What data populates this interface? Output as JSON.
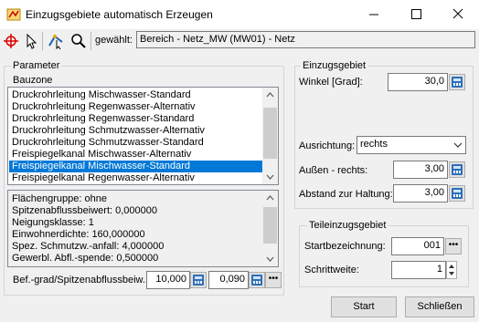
{
  "window": {
    "title": "Einzugsgebiete automatisch Erzeugen"
  },
  "toolbar": {
    "selected_label": "gewählt:",
    "selected_value": "Bereich - Netz_MW (MW01) - Netz"
  },
  "parameter": {
    "group_label": "Parameter",
    "bauzone_label": "Bauzone",
    "list_items": [
      "Druckrohrleitung Mischwasser-Standard",
      "Druckrohrleitung Regenwasser-Alternativ",
      "Druckrohrleitung Regenwasser-Standard",
      "Druckrohrleitung Schmutzwasser-Alternativ",
      "Druckrohrleitung Schmutzwasser-Standard",
      "Freispiegelkanal Mischwasser-Alternativ",
      "Freispiegelkanal Mischwasser-Standard",
      "Freispiegelkanal Regenwasser-Alternativ"
    ],
    "selected_index": 6,
    "info_lines": [
      "Flächengruppe: ohne",
      "Spitzenabflussbeiwert: 0,000000",
      "Neigungsklasse: 1",
      "Einwohnerdichte: 160,000000",
      "Spez. Schmutzw.-anfall: 4,000000",
      "Gewerbl. Abfl.-spende: 0,500000"
    ],
    "bef_label": "Bef.-grad/Spitzenabflussbeiw...",
    "bef_value1": "10,000",
    "bef_value2": "0,090"
  },
  "einzugsgebiet": {
    "group_label": "Einzugsgebiet",
    "winkel_label": "Winkel [Grad]:",
    "winkel_value": "30,0",
    "ausrichtung_label": "Ausrichtung:",
    "ausrichtung_value": "rechts",
    "aussen_label": "Außen - rechts:",
    "aussen_value": "3,00",
    "abstand_label": "Abstand zur Haltung:",
    "abstand_value": "3,00"
  },
  "teileinzugsgebiet": {
    "group_label": "Teileinzugsgebiet",
    "start_label": "Startbezeichnung:",
    "start_value": "001",
    "schritt_label": "Schrittweite:",
    "schritt_value": "1"
  },
  "buttons": {
    "start": "Start",
    "close": "Schließen"
  }
}
